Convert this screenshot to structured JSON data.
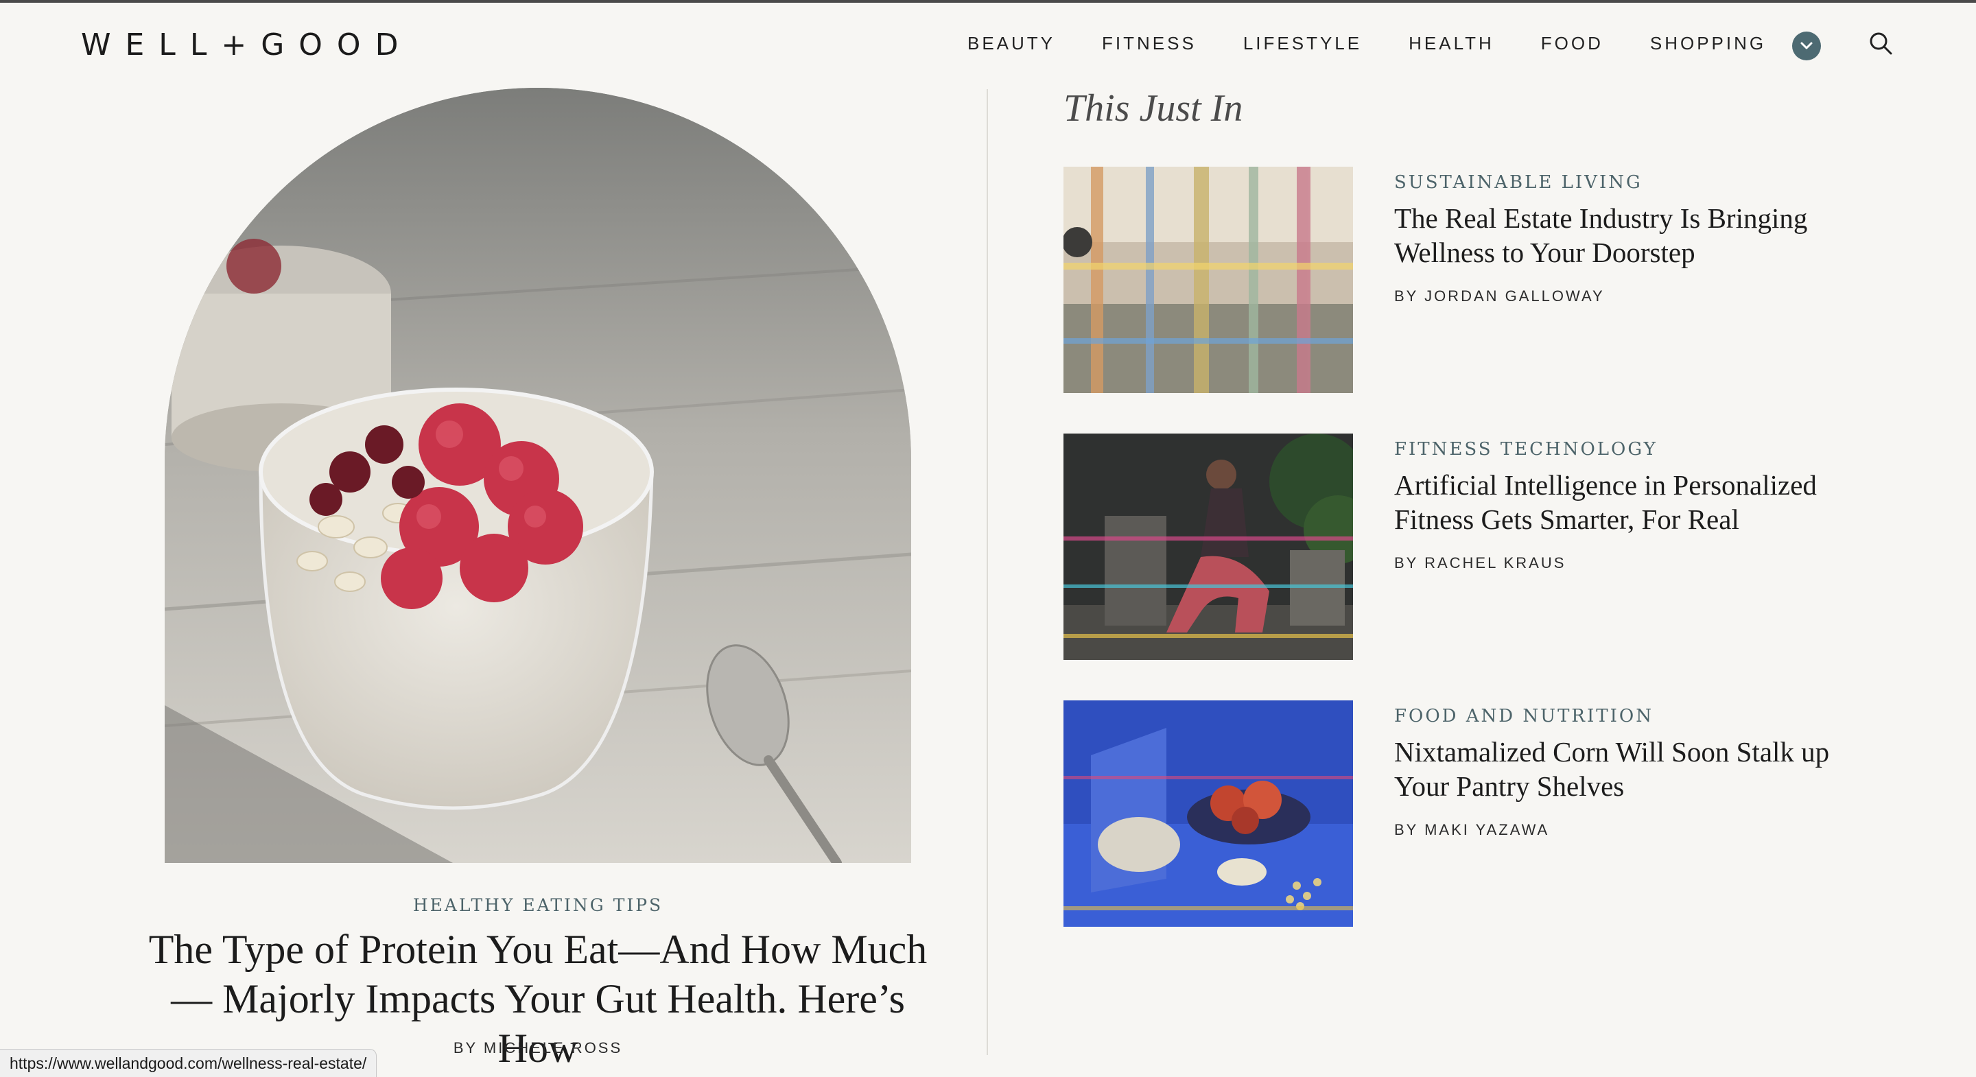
{
  "brand": {
    "logo_text": "WELL+GOOD"
  },
  "nav": {
    "items": [
      "BEAUTY",
      "FITNESS",
      "LIFESTYLE",
      "HEALTH",
      "FOOD",
      "SHOPPING"
    ],
    "toggle_icon": "chevron-down-icon",
    "search_icon": "search-icon",
    "accent_color": "#4d6a72"
  },
  "featured": {
    "category": "HEALTHY EATING TIPS",
    "title": "The Type of Protein You Eat—And How Much— Majorly Impacts Your Gut Health. Here’s How",
    "author": "BY MICHELE ROSS"
  },
  "just_in": {
    "heading": "This Just In",
    "stories": [
      {
        "category": "SUSTAINABLE LIVING",
        "title": "The Real Estate Industry Is Bringing Wellness to Your Doorstep",
        "author": "BY JORDAN GALLOWAY"
      },
      {
        "category": "FITNESS TECHNOLOGY",
        "title": "Artificial Intelligence in Personalized Fitness Gets Smarter, For Real",
        "author": "BY RACHEL KRAUS"
      },
      {
        "category": "FOOD AND NUTRITION",
        "title": "Nixtamalized Corn Will Soon Stalk up Your Pantry Shelves",
        "author": "BY MAKI YAZAWA"
      }
    ]
  },
  "status_bar": {
    "url": "https://www.wellandgood.com/wellness-real-estate/"
  }
}
